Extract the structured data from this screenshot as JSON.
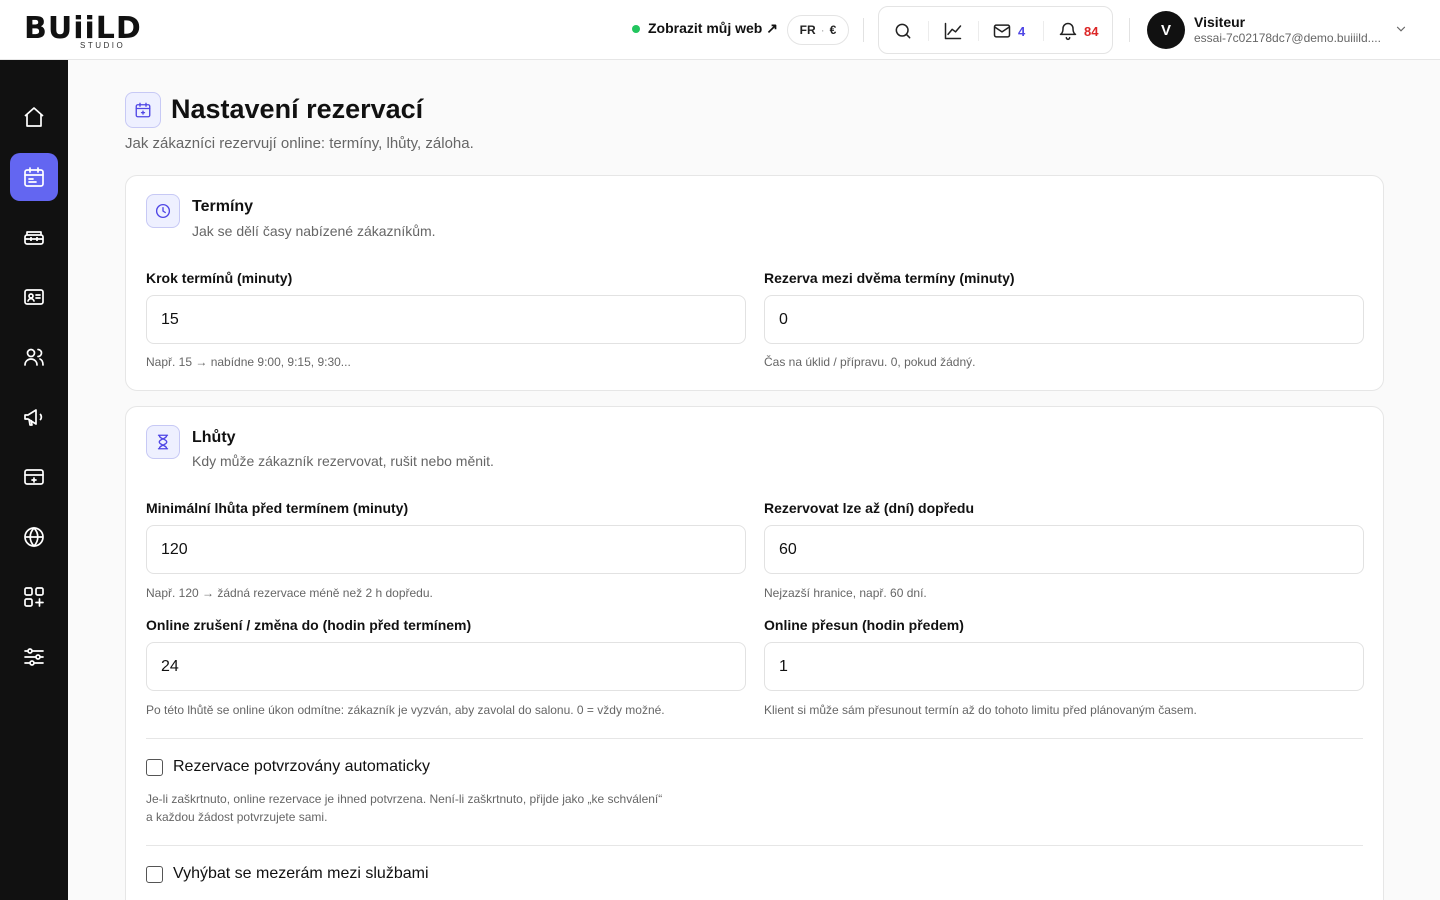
{
  "header": {
    "logo_main": "BUiiLD",
    "logo_sub": "STUDIO",
    "view_site_label": "Zobrazit můj web ↗",
    "lang": "FR",
    "currency": "€",
    "mail_count": "4",
    "notif_count": "84",
    "user_initial": "V",
    "user_name": "Visiteur",
    "user_email": "essai-7c02178dc7@demo.buiiild...."
  },
  "sidebar": {
    "items": [
      {
        "icon": "home-icon"
      },
      {
        "icon": "calendar-icon",
        "active": true
      },
      {
        "icon": "inventory-icon"
      },
      {
        "icon": "id-card-icon"
      },
      {
        "icon": "users-icon"
      },
      {
        "icon": "megaphone-icon"
      },
      {
        "icon": "payment-icon"
      },
      {
        "icon": "globe-icon"
      },
      {
        "icon": "apps-icon"
      },
      {
        "icon": "sliders-icon"
      }
    ]
  },
  "page": {
    "title": "Nastavení rezervací",
    "subtitle": "Jak zákazníci rezervují online: termíny, lhůty, záloha."
  },
  "sections": {
    "terminy": {
      "title": "Termíny",
      "desc": "Jak se dělí časy nabízené zákazníkům.",
      "fields": {
        "step": {
          "label": "Krok termínů (minuty)",
          "value": "15",
          "hint": "Např. 15 → nabídne 9:00, 9:15, 9:30..."
        },
        "buffer": {
          "label": "Rezerva mezi dvěma termíny (minuty)",
          "value": "0",
          "hint": "Čas na úklid / přípravu. 0, pokud žádný."
        }
      }
    },
    "lhuty": {
      "title": "Lhůty",
      "desc": "Kdy může zákazník rezervovat, rušit nebo měnit.",
      "fields": {
        "min_notice": {
          "label": "Minimální lhůta před termínem (minuty)",
          "value": "120",
          "hint": "Např. 120 → žádná rezervace méně než 2 h dopředu."
        },
        "max_days": {
          "label": "Rezervovat lze až (dní) dopředu",
          "value": "60",
          "hint": "Nejzazší hranice, např. 60 dní."
        },
        "cancel": {
          "label": "Online zrušení / změna do (hodin před termínem)",
          "value": "24",
          "hint": "Po této lhůtě se online úkon odmítne: zákazník je vyzván, aby zavolal do salonu. 0 = vždy možné."
        },
        "reschedule": {
          "label": "Online přesun (hodin předem)",
          "value": "1",
          "hint": "Klient si může sám přesunout termín až do tohoto limitu před plánovaným časem."
        }
      },
      "auto_confirm": {
        "label": "Rezervace potvrzovány automaticky",
        "checked": false,
        "hint": "Je-li zaškrtnuto, online rezervace je ihned potvrzena. Není-li zaškrtnuto, přijde jako „ke schválení“ a každou žádost potvrzujete sami."
      },
      "avoid_gaps": {
        "label": "Vyhýbat se mezerám mezi službami",
        "checked": false
      }
    }
  }
}
